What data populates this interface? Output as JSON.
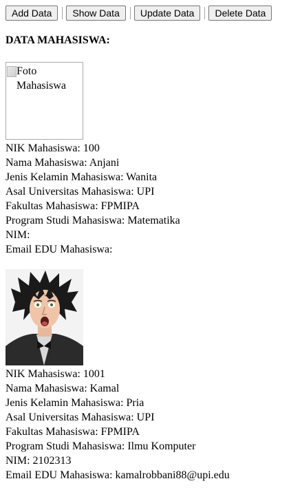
{
  "toolbar": {
    "add_label": "Add Data",
    "show_label": "Show Data",
    "update_label": "Update Data",
    "delete_label": "Delete Data"
  },
  "heading": "DATA MAHASISWA:",
  "students": [
    {
      "photo_alt": "Foto Mahasiswa",
      "photo_loaded": false,
      "nik": "NIK Mahasiswa: 100",
      "nama": "Nama Mahasiswa: Anjani",
      "jenis_kelamin": "Jenis Kelamin Mahasiswa: Wanita",
      "asal_universitas": "Asal Universitas Mahasiswa: UPI",
      "fakultas": "Fakultas Mahasiswa: FPMIPA",
      "program_studi": "Program Studi Mahasiswa: Matematika",
      "nim": "NIM:",
      "email": "Email EDU Mahasiswa:"
    },
    {
      "photo_loaded": true,
      "nik": "NIK Mahasiswa: 1001",
      "nama": "Nama Mahasiswa: Kamal",
      "jenis_kelamin": "Jenis Kelamin Mahasiswa: Pria",
      "asal_universitas": "Asal Universitas Mahasiswa: UPI",
      "fakultas": "Fakultas Mahasiswa: FPMIPA",
      "program_studi": "Program Studi Mahasiswa: Ilmu Komputer",
      "nim": "NIM: 2102313",
      "email": "Email EDU Mahasiswa: kamalrobbani88@upi.edu"
    }
  ]
}
